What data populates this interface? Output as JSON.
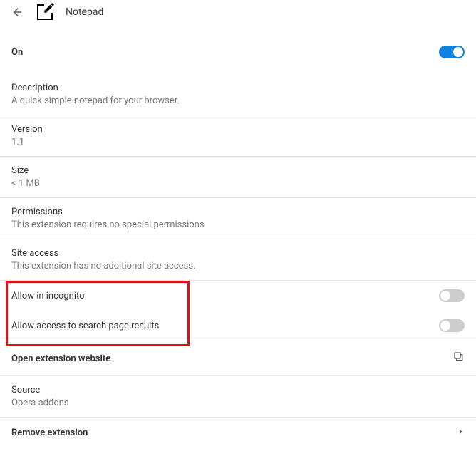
{
  "header": {
    "title": "Notepad"
  },
  "status": {
    "on_label": "On"
  },
  "description": {
    "label": "Description",
    "text": "A quick simple notepad for your browser."
  },
  "version": {
    "label": "Version",
    "value": "1.1"
  },
  "size": {
    "label": "Size",
    "value": "< 1 MB"
  },
  "permissions": {
    "label": "Permissions",
    "text": "This extension requires no special permissions"
  },
  "site_access": {
    "label": "Site access",
    "text": "This extension has no additional site access."
  },
  "incognito": {
    "label": "Allow in incognito"
  },
  "search_access": {
    "label": "Allow access to search page results"
  },
  "open_website": {
    "label": "Open extension website"
  },
  "source": {
    "label": "Source",
    "value": "Opera addons"
  },
  "remove": {
    "label": "Remove extension"
  }
}
